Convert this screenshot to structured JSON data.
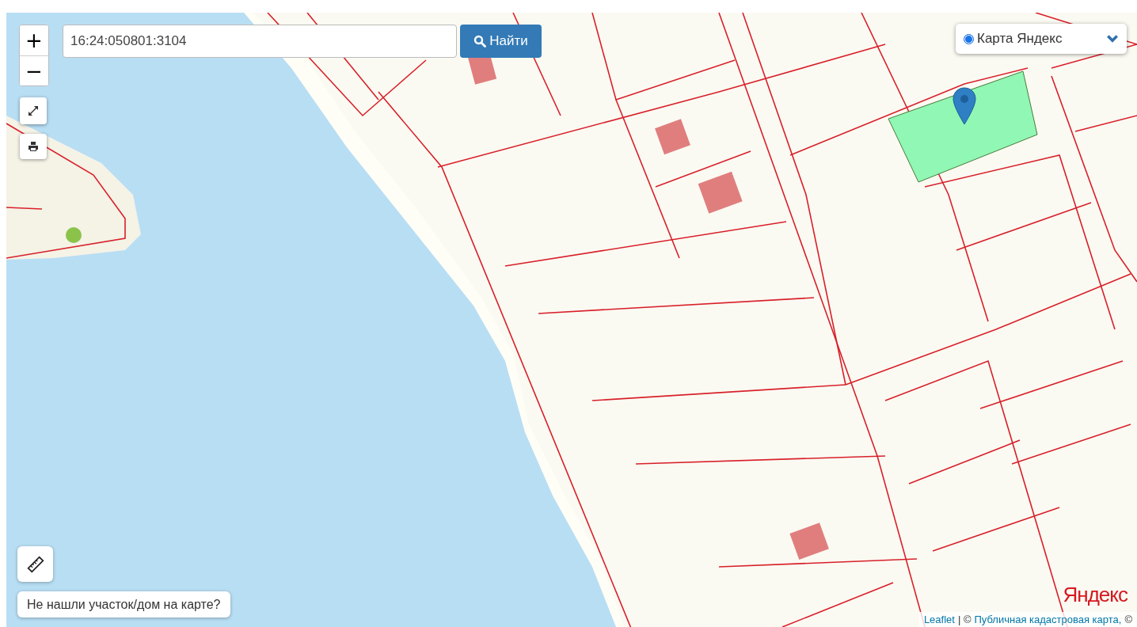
{
  "search": {
    "value": "16:24:050801:3104"
  },
  "search_button": {
    "label": "Найти"
  },
  "zoom": {
    "in": "+",
    "out": "−"
  },
  "layer_select": {
    "label": "Карта Яндекс",
    "selected": true
  },
  "help_button": {
    "label": "Не нашли участок/дом на карте?"
  },
  "map_logo": {
    "text": "Яндекс"
  },
  "attribution": [
    {
      "kind": "link",
      "text": "Leaflet"
    },
    {
      "kind": "text",
      "text": "| ©"
    },
    {
      "kind": "link",
      "text": "Публичная кадастровая карта,"
    },
    {
      "kind": "text",
      "text": "©"
    }
  ]
}
